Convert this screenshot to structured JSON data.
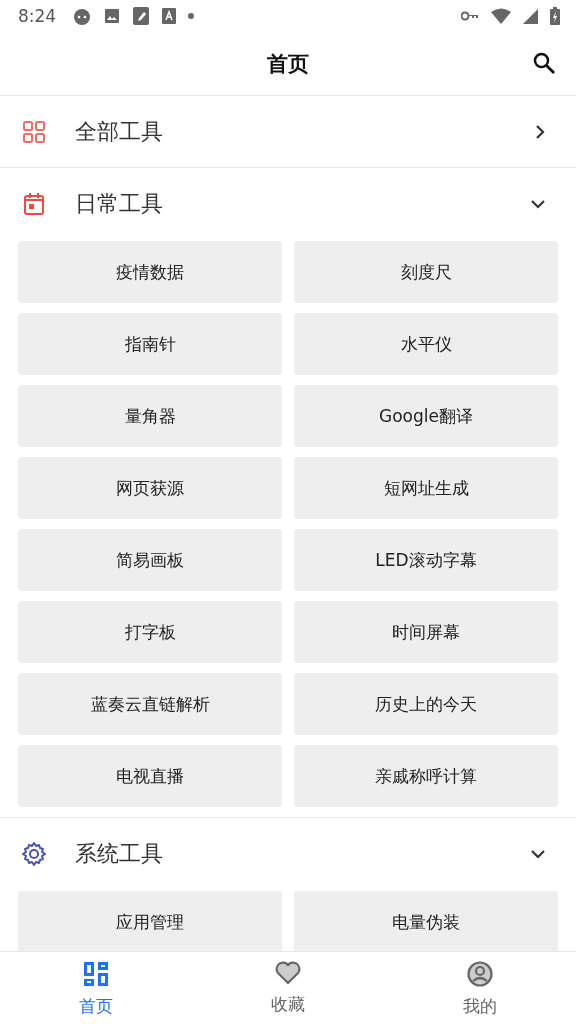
{
  "status_bar": {
    "time": "8:24"
  },
  "app_bar": {
    "title": "首页"
  },
  "sections": [
    {
      "kind": "link",
      "title": "全部工具"
    },
    {
      "kind": "group",
      "title": "日常工具",
      "expanded": true,
      "tools": [
        "疫情数据",
        "刻度尺",
        "指南针",
        "水平仪",
        "量角器",
        "Google翻译",
        "网页获源",
        "短网址生成",
        "简易画板",
        "LED滚动字幕",
        "打字板",
        "时间屏幕",
        "蓝奏云直链解析",
        "历史上的今天",
        "电视直播",
        "亲戚称呼计算"
      ]
    },
    {
      "kind": "group",
      "title": "系统工具",
      "expanded": true,
      "tools": [
        "应用管理",
        "电量伪装"
      ]
    }
  ],
  "bottom_nav": [
    {
      "label": "首页",
      "selected": true
    },
    {
      "label": "收藏",
      "selected": false
    },
    {
      "label": "我的",
      "selected": false
    }
  ]
}
